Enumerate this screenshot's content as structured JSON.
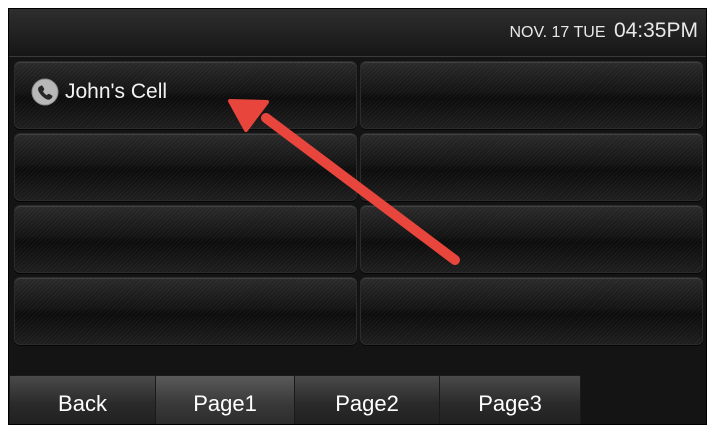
{
  "status_bar": {
    "date": "NOV. 17 TUE",
    "time": "04:35PM"
  },
  "grid": {
    "tiles": [
      {
        "label": "John's Cell",
        "icon": "phone-icon"
      },
      {
        "label": ""
      },
      {
        "label": ""
      },
      {
        "label": ""
      },
      {
        "label": ""
      },
      {
        "label": ""
      },
      {
        "label": ""
      },
      {
        "label": ""
      }
    ]
  },
  "nav": {
    "back": "Back",
    "page1": "Page1",
    "page2": "Page2",
    "page3": "Page3",
    "active": "Page1"
  },
  "colors": {
    "annotation_arrow": "#e8453c"
  }
}
